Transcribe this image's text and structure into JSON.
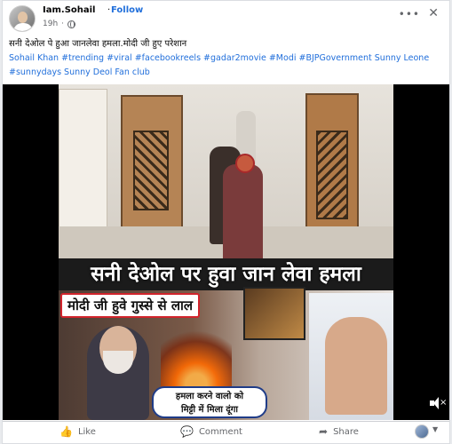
{
  "post": {
    "author": "Iam.Sohail",
    "dot": "·",
    "follow": "Follow",
    "time": "19h",
    "dot2": "·",
    "more": "•••",
    "close": "✕",
    "text": "सनी देओल पे हुआ जानलेवा हमला.मोदी जी हुए परेशान",
    "tags": "Sohail Khan #trending #viral #facebookreels #gadar2movie #Modi #BJPGovernment Sunny Leone #sunnydays Sunny Deol Fan club"
  },
  "video": {
    "headline": "सनी देओल पर हुवा जान लेवा हमला",
    "subheadline": "मोदी जी हुवे गुस्से से लाल",
    "bubble_line1": "हमला करने वालो को",
    "bubble_line2": "मिट्टी में मिला दूंगा",
    "mute_icon": "speaker-muted-icon"
  },
  "actions": {
    "like": "Like",
    "comment": "Comment",
    "share": "Share"
  },
  "icons": {
    "like": "👍",
    "comment": "💬",
    "share": "➦"
  }
}
